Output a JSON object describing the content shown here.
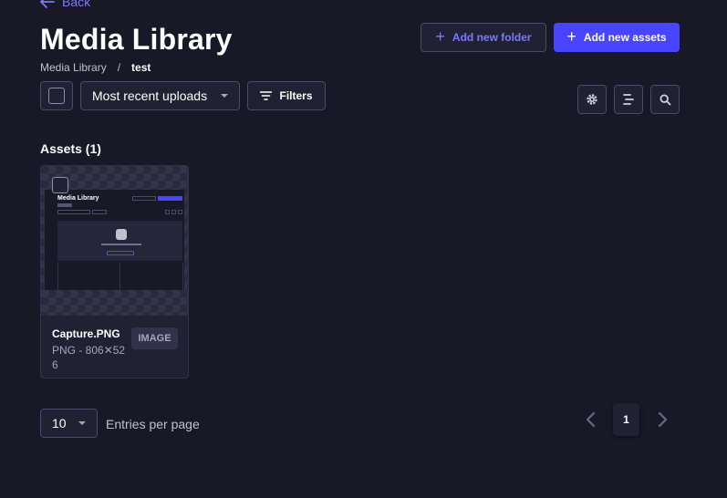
{
  "nav": {
    "back_label": "Back"
  },
  "header": {
    "title": "Media Library",
    "breadcrumb": {
      "root": "Media Library",
      "separator": "/",
      "current": "test"
    },
    "add_folder_label": "Add new folder",
    "add_assets_label": "Add new assets"
  },
  "toolbar": {
    "sort_label": "Most recent uploads",
    "filters_label": "Filters",
    "icons": [
      "gear-icon",
      "list-view-icon",
      "search-icon"
    ]
  },
  "assets": {
    "section_title": "Assets (1)",
    "items": [
      {
        "name": "Capture.PNG",
        "meta": "PNG - 806✕526",
        "type_badge": "IMAGE",
        "preview": {
          "title": "Media Library"
        }
      }
    ]
  },
  "pagination": {
    "page_size": "10",
    "entries_label": "Entries per page",
    "current_page": "1"
  },
  "colors": {
    "background": "#181826",
    "surface": "#212134",
    "border": "#4a4a6a",
    "primary": "#4945ff",
    "primary_text": "#7b79ff"
  }
}
